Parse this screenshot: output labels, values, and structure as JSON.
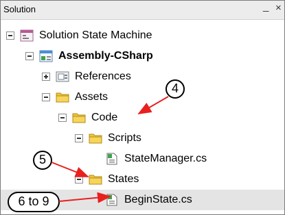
{
  "panel": {
    "title": "Solution"
  },
  "tree": {
    "solution": "Solution State Machine",
    "project": "Assembly-CSharp",
    "references": "References",
    "assets": "Assets",
    "code": "Code",
    "scripts": "Scripts",
    "state_manager": "StateManager.cs",
    "states": "States",
    "begin_state": "BeginState.cs"
  },
  "callouts": {
    "c4": "4",
    "c5": "5",
    "c6to9": "6 to 9"
  },
  "colors": {
    "arrow": "#e8201f",
    "folder": "#f2c43a",
    "selected_row": "#e4e4e4"
  }
}
